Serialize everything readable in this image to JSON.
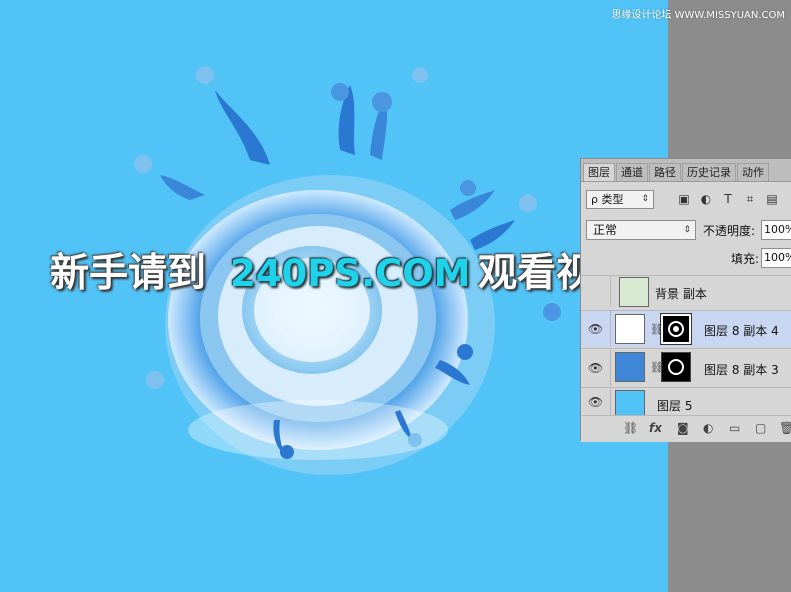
{
  "watermark": "思缘设计论坛 WWW.MISSYUAN.COM",
  "overlay": {
    "part1": "新手请到",
    "part2": "240PS.COM",
    "part3": "观看视频教程"
  },
  "colors": {
    "canvas": "#52c3f6",
    "pasteboard": "#8c8c8c",
    "panel": "#d6d6d6",
    "selected_layer": "#c9d6f2",
    "accent_text": "#1ed3e9"
  },
  "panel": {
    "tabs": [
      "图层",
      "通道",
      "路径",
      "历史记录",
      "动作"
    ],
    "active_tab": "图层",
    "filter_label": "ρ 类型",
    "filter_icons": [
      "image-filter-icon",
      "adjustment-filter-icon",
      "type-filter-icon",
      "shape-filter-icon",
      "smart-object-filter-icon"
    ],
    "blend_mode": "正常",
    "opacity_label": "不透明度:",
    "opacity_value": "100%",
    "fill_label": "填充:",
    "fill_value": "100%",
    "layers": [
      {
        "name": "背景 副本",
        "visible": false,
        "selected": false
      },
      {
        "name": "图层 8 副本 4",
        "visible": true,
        "selected": true
      },
      {
        "name": "图层 8 副本 3",
        "visible": true,
        "selected": false
      },
      {
        "name": "图层 5",
        "visible": true,
        "selected": false
      }
    ],
    "footer_icons": [
      "link-layers-icon",
      "fx-icon",
      "add-mask-icon",
      "adjustment-layer-icon",
      "new-group-icon",
      "new-layer-icon",
      "delete-icon"
    ],
    "fx_label": "fx"
  }
}
